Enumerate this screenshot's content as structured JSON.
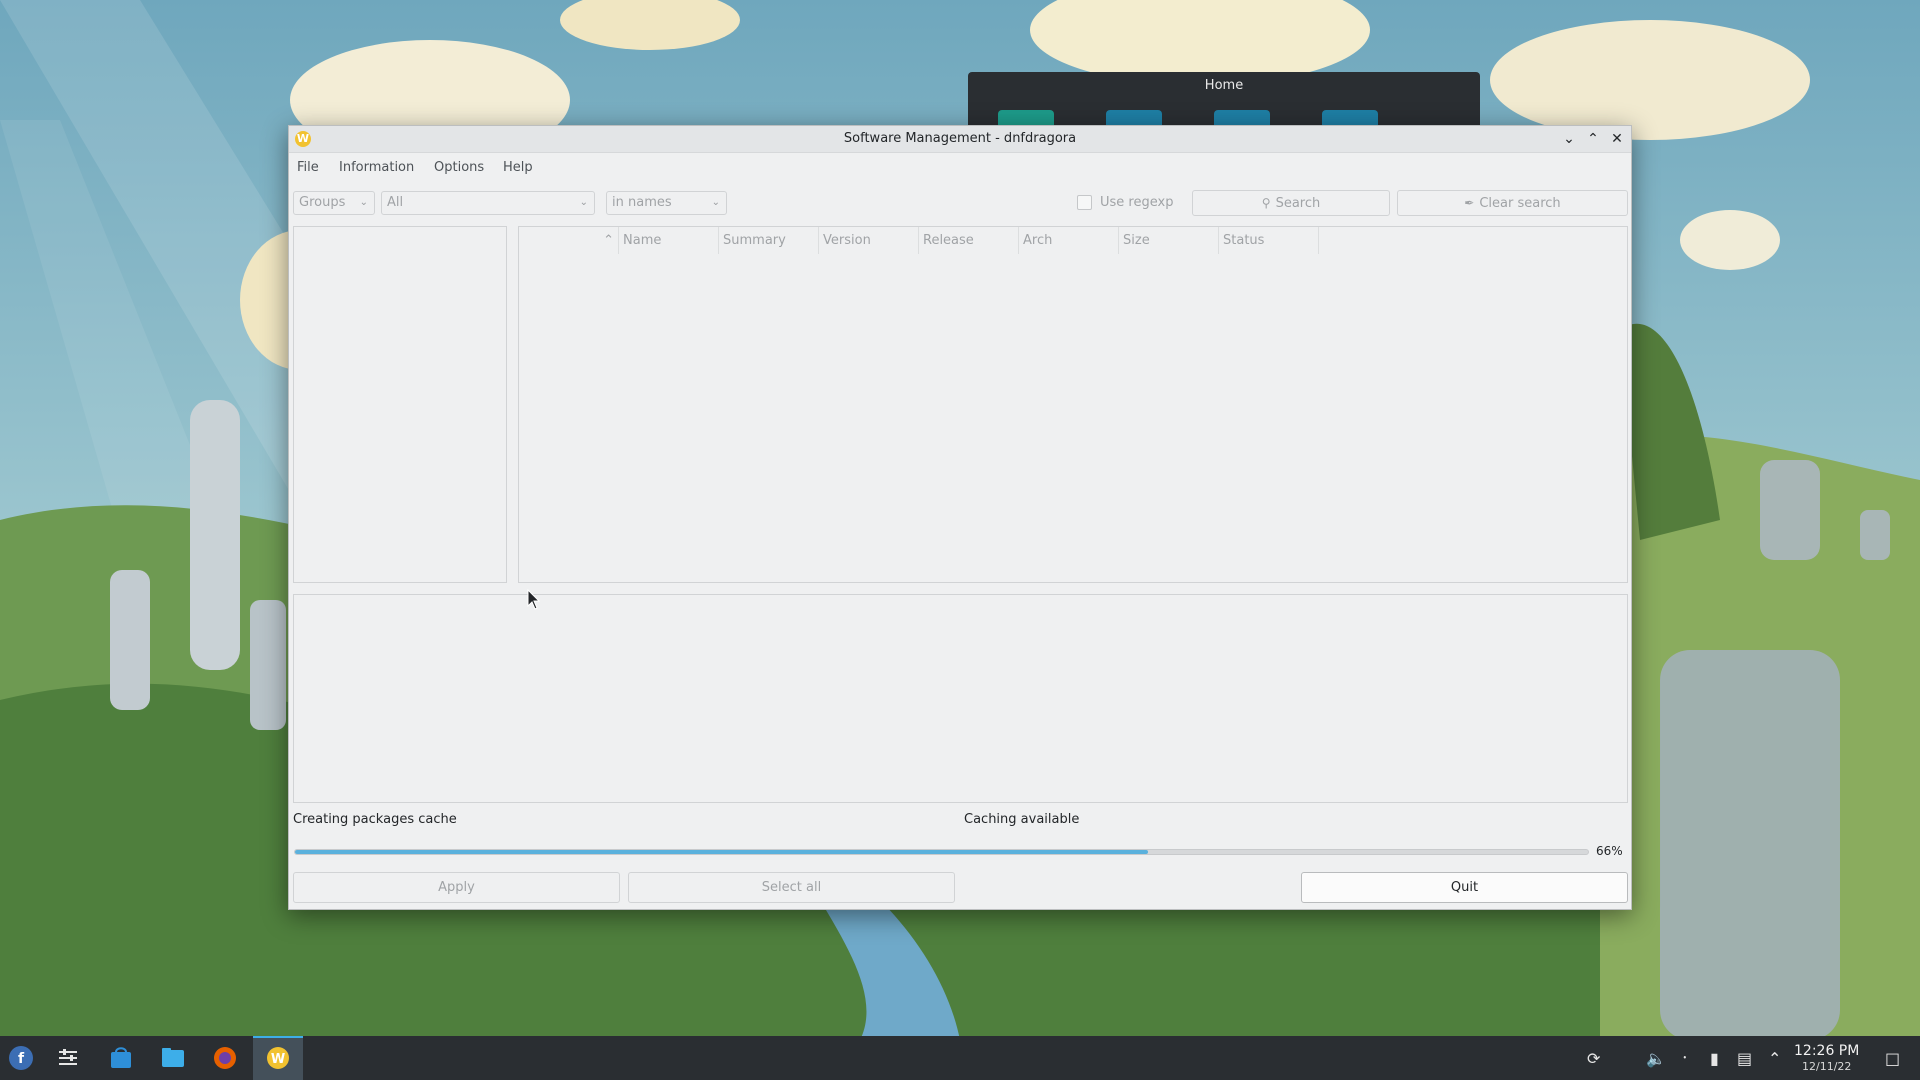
{
  "background_window": {
    "title": "Home"
  },
  "window": {
    "title": "Software Management - dnfdragora",
    "app_icon_glyph": "W"
  },
  "menu": {
    "items": [
      "File",
      "Information",
      "Options",
      "Help"
    ]
  },
  "filters": {
    "view_combo": "Groups",
    "filter_combo": "All",
    "search_scope_combo": "in names",
    "use_regexp_label": "Use regexp",
    "use_regexp_checked": false,
    "search_button": "Search",
    "clear_search_button": "Clear search"
  },
  "package_table": {
    "columns": [
      "Name",
      "Summary",
      "Version",
      "Release",
      "Arch",
      "Size",
      "Status"
    ],
    "rows": []
  },
  "status": {
    "left_text": "Creating packages cache",
    "right_text": "Caching available",
    "progress_percent": 66,
    "progress_label": "66%"
  },
  "buttons": {
    "apply": "Apply",
    "select_all": "Select all",
    "quit": "Quit"
  },
  "taskbar": {
    "time": "12:26 PM",
    "date": "12/11/22"
  },
  "colors": {
    "accent": "#3daee9",
    "progress": "#5ab1dd"
  }
}
